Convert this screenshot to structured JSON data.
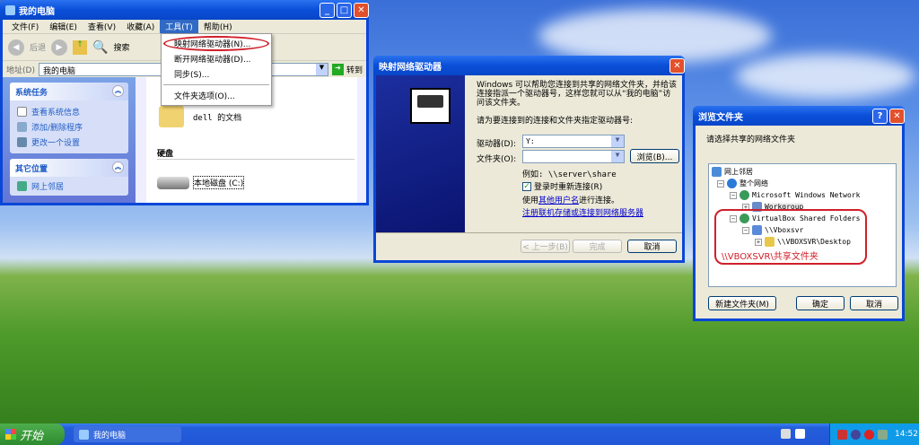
{
  "explorer": {
    "title": "我的电脑",
    "menu": [
      "文件(F)",
      "编辑(E)",
      "查看(V)",
      "收藏(A)",
      "工具(T)",
      "帮助(H)"
    ],
    "back": "后退",
    "search": "搜索",
    "address_label": "地址(D)",
    "address": "我的电脑",
    "go": "转到",
    "tasks_title": "系统任务",
    "tasks": [
      "查看系统信息",
      "添加/删除程序",
      "更改一个设置"
    ],
    "other_title": "其它位置",
    "other": [
      "网上邻居"
    ],
    "folder": "dell 的文档",
    "section": "硬盘",
    "drive": "本地磁盘 (C:)"
  },
  "tools_menu": [
    "映射网络驱动器(N)...",
    "断开网络驱动器(D)...",
    "同步(S)...",
    "文件夹选项(O)..."
  ],
  "map": {
    "title": "映射网络驱动器",
    "intro": "Windows 可以帮助您连接到共享的网络文件夹，并给该连接指派一个驱动器号，这样您就可以从“我的电脑”访问该文件夹。",
    "prompt": "请为要连接到的连接和文件夹指定驱动器号:",
    "drive_label": "驱动器(D):",
    "drive_value": "Y:",
    "folder_label": "文件夹(O):",
    "folder_value": "",
    "browse": "浏览(B)...",
    "example": "例如: \\\\server\\share",
    "reconnect": "登录时重新连接(R)",
    "reconnect_checked": true,
    "other_user_pre": "使用",
    "other_user_link": "其他用户名",
    "other_user_post": "进行连接。",
    "register_link": "注册联机存储或连接到网络服务器",
    "back": "< 上一步(B)",
    "finish": "完成",
    "cancel": "取消"
  },
  "browse": {
    "title": "浏览文件夹",
    "prompt": "请选择共享的网络文件夹",
    "tree": [
      "网上邻居",
      "整个网络",
      "Microsoft Windows Network",
      "Workgroup",
      "VirtualBox Shared Folders",
      "\\\\Vboxsvr",
      "\\\\VBOXSVR\\Desktop"
    ],
    "annotation": "\\\\VBOXSVR\\共享文件夹",
    "new_folder": "新建文件夹(M)",
    "ok": "确定",
    "cancel": "取消",
    "help": "?"
  },
  "taskbar": {
    "start": "开始",
    "task": "我的电脑",
    "clock": "14:52"
  },
  "colors": {
    "accent": "#0a46d8",
    "annotation": "#d0202a"
  }
}
